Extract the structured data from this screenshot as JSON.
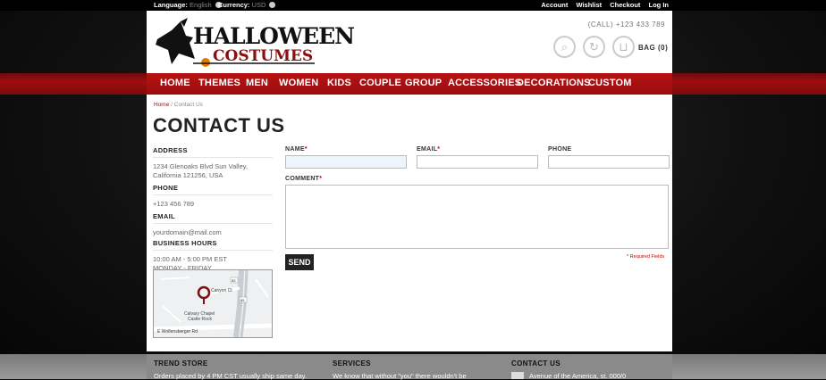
{
  "topbar": {
    "language_label": "Language:",
    "language_value": "English",
    "currency_label": "Currency:",
    "currency_value": "USD",
    "links": [
      "Account",
      "Wishlist",
      "Checkout",
      "Log In"
    ]
  },
  "header": {
    "logo_line1": "HALLOWEEN",
    "logo_line2": "COSTUMES",
    "call": "(CALL) +123 433 789",
    "bag": "BAG (0)"
  },
  "nav": {
    "items": [
      "HOME",
      "THEMES",
      "MEN",
      "WOMEN",
      "KIDS",
      "COUPLE",
      "GROUP",
      "ACCESSORIES",
      "DECORATIONS",
      "CUSTOM"
    ]
  },
  "breadcrumb": {
    "home": "Home",
    "separator": "/",
    "current": "Contact Us"
  },
  "page_title": "CONTACT US",
  "sidebar": {
    "address_heading": "ADDRESS",
    "address_line1": "1234 Glenoaks Blvd Sun Valley,",
    "address_line2": "California 121256, USA",
    "phone_heading": "PHONE",
    "phone": "+123 456 789",
    "email_heading": "EMAIL",
    "email": "yourdomain@mail.com",
    "hours_heading": "BUSINESS HOURS",
    "hours_line1": "10:00 AM - 5:00 PM EST",
    "hours_line2": "MONDAY - FRIDAY"
  },
  "map": {
    "place_name_1": "Calvary Chapel",
    "place_name_2": "Castle Rock",
    "street": "E Wolfensberger Rd",
    "street2": "Canyon Ct",
    "route_badge_1": "85",
    "route_badge_2": "85"
  },
  "form": {
    "name_label": "NAME",
    "email_label": "EMAIL",
    "phone_label": "PHONE",
    "comment_label": "COMMENT",
    "required_mark": "*",
    "send_label": "SEND",
    "required_note": "* Required Fields",
    "name_value": "",
    "email_value": "",
    "phone_value": "",
    "comment_value": ""
  },
  "footer": {
    "col1_heading": "TREND STORE",
    "col1_text": "Orders placed by 4 PM CST usually ship same day.",
    "col2_heading": "SERVICES",
    "col2_text": "We know that without \"you\" there wouldn't be",
    "col3_heading": "CONTACT US",
    "col3_text": "Avenue of the America, st. 000/0"
  },
  "colors": {
    "brand_red": "#a00e0e",
    "dark_red": "#8a1010",
    "required_red": "#cc0000"
  },
  "icons": [
    "search-icon",
    "refresh-icon",
    "basket-icon",
    "globe-icon",
    "currency-icon",
    "map-pin-icon"
  ]
}
